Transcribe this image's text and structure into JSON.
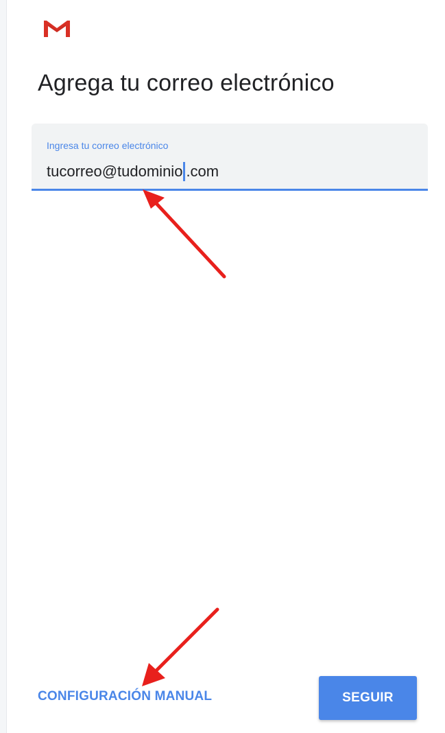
{
  "header": {
    "logo_icon": "gmail-m-icon",
    "title": "Agrega tu correo electrónico"
  },
  "email_field": {
    "label": "Ingresa tu correo electrónico",
    "value_before_cursor": "tucorreo@tudominio",
    "value_after_cursor": ".com"
  },
  "footer": {
    "manual_setup_label": "CONFIGURACIÓN MANUAL",
    "next_label": "SEGUIR"
  },
  "colors": {
    "accent": "#4a86e8",
    "annotation_arrow": "#e8201c",
    "gmail_red": "#d93025"
  }
}
